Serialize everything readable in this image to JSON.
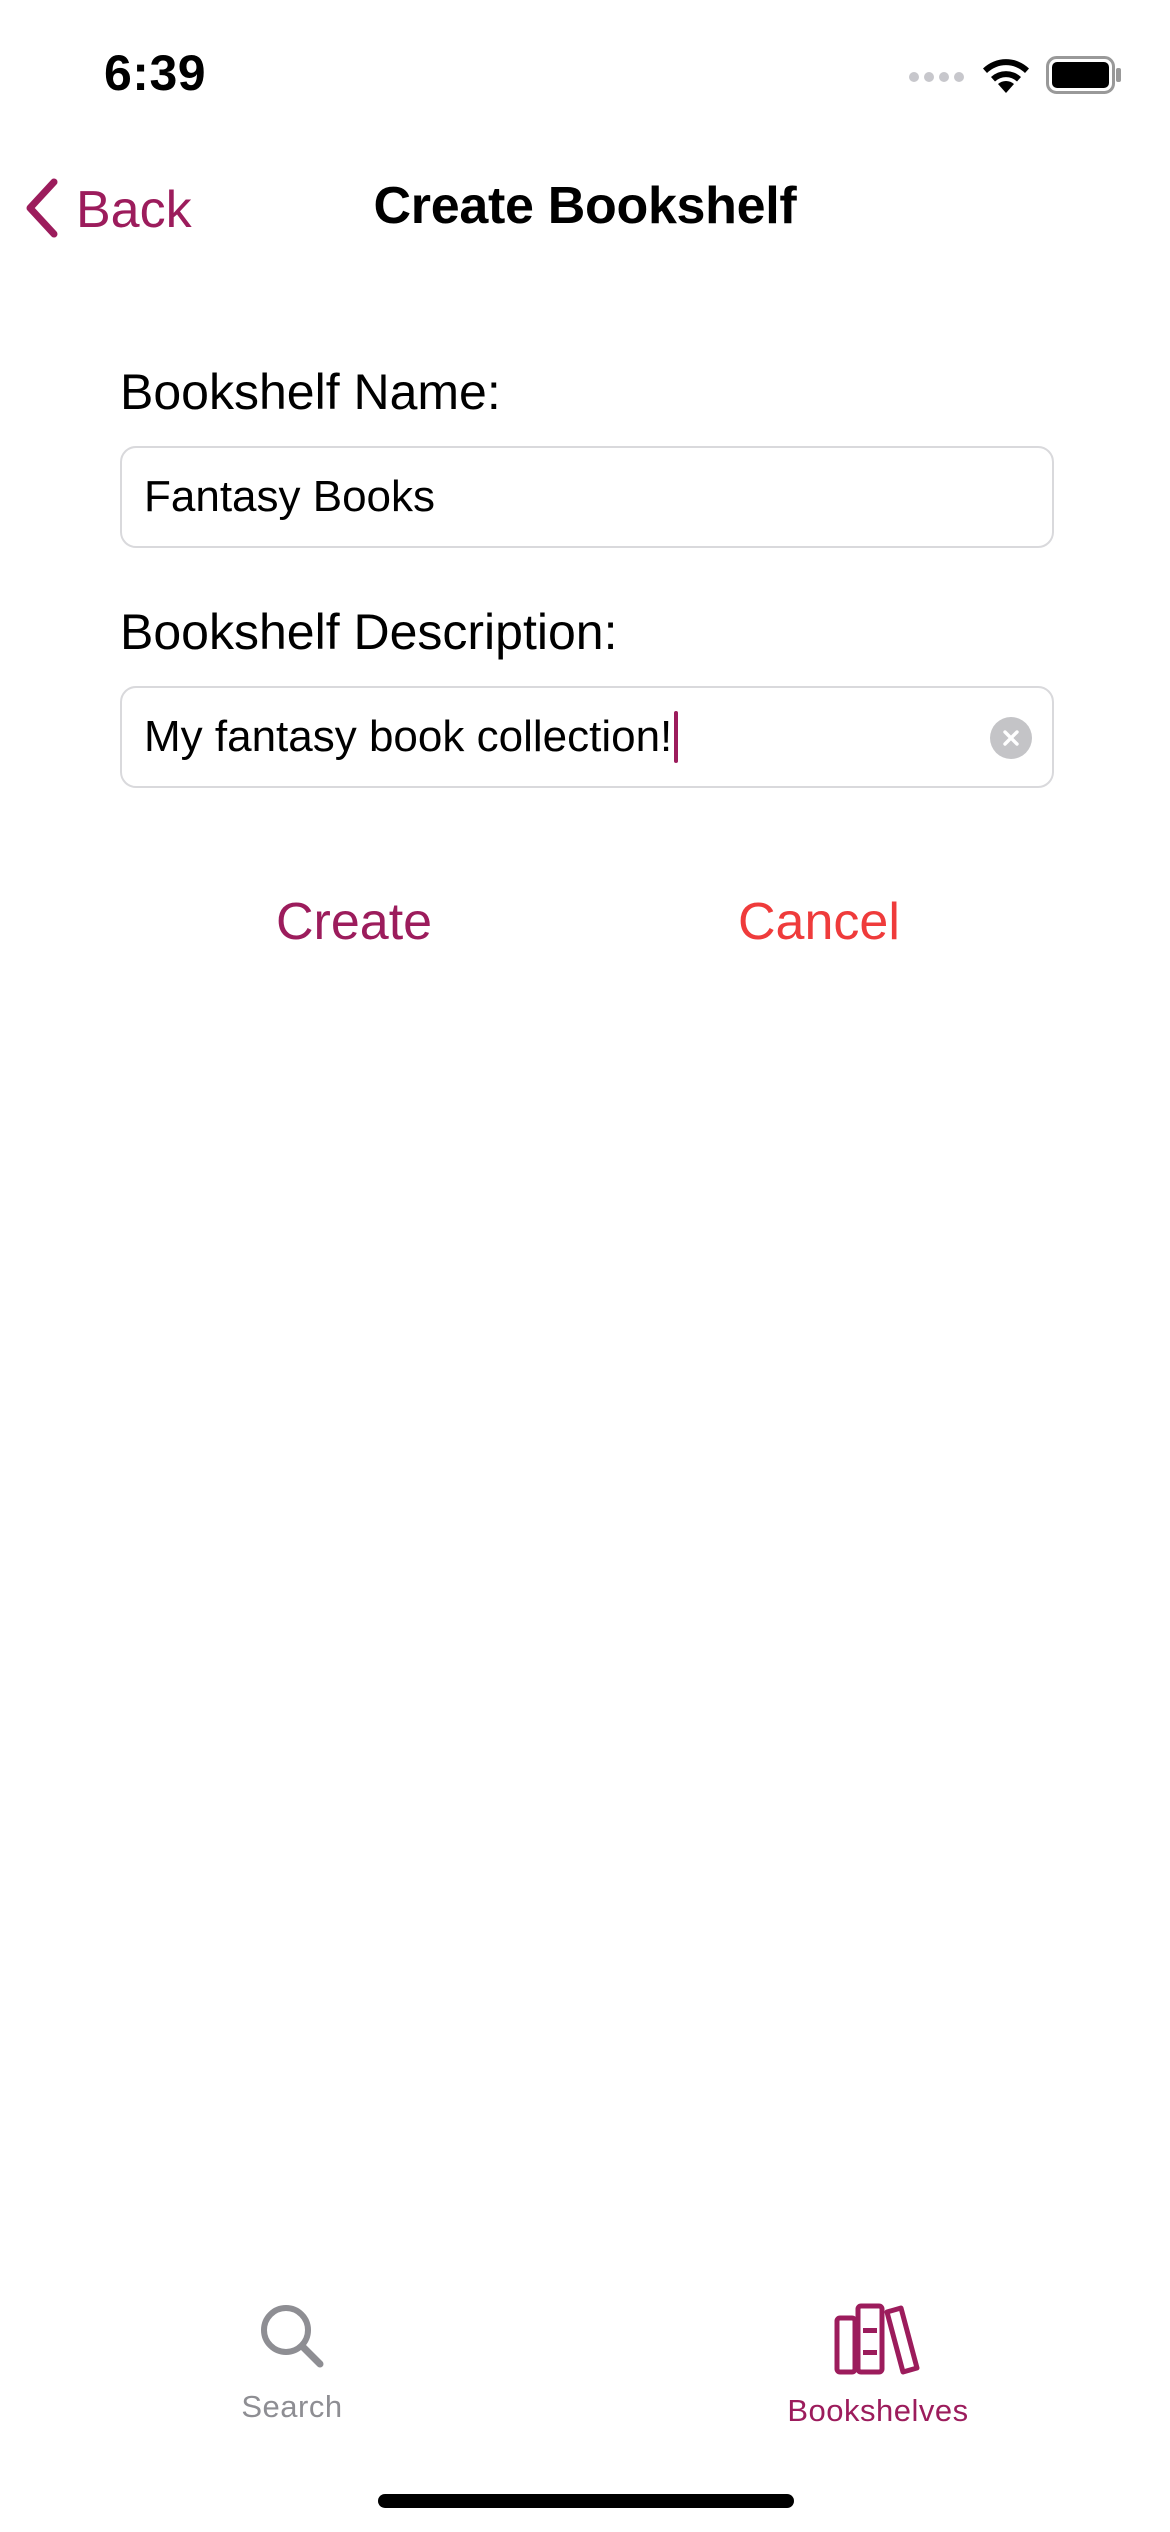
{
  "status_bar": {
    "time": "6:39",
    "icons": [
      "signal-icon",
      "wifi-icon",
      "battery-icon"
    ]
  },
  "nav": {
    "back_label": "Back",
    "title": "Create Bookshelf"
  },
  "form": {
    "name_label": "Bookshelf Name:",
    "name_value": "Fantasy Books",
    "description_label": "Bookshelf Description:",
    "description_value": "My fantasy book collection!"
  },
  "actions": {
    "create_label": "Create",
    "cancel_label": "Cancel"
  },
  "tab_bar": {
    "items": [
      {
        "label": "Search",
        "icon": "search-icon",
        "selected": false
      },
      {
        "label": "Bookshelves",
        "icon": "bookshelves-icon",
        "selected": true
      }
    ]
  },
  "colors": {
    "accent": "#9c1c5c",
    "destructive": "#ef3b3b",
    "inactive": "#8e8e93",
    "field_border": "#d9d9dc"
  }
}
